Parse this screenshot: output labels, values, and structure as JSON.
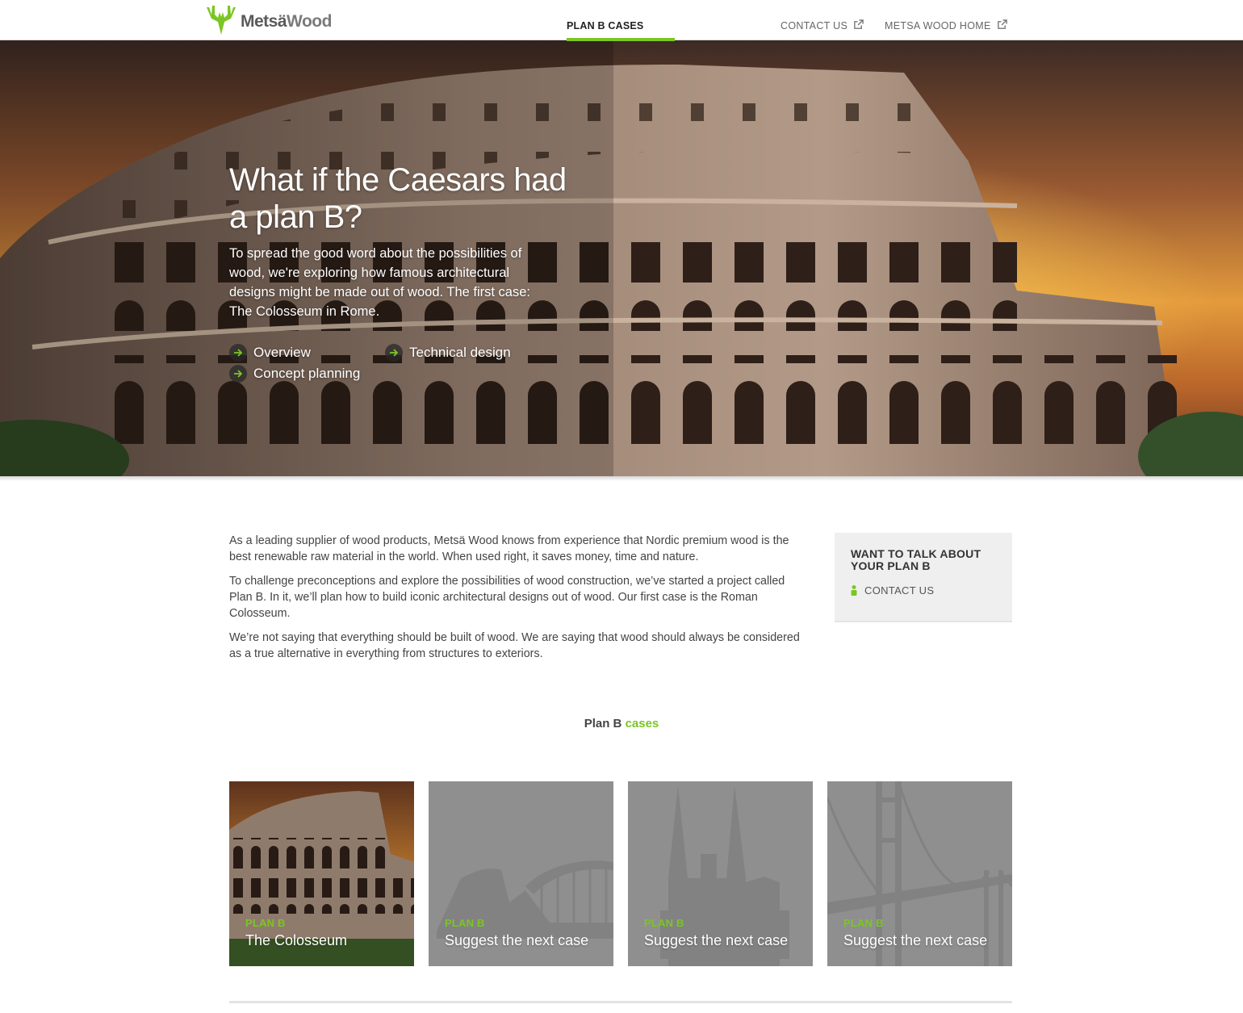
{
  "header": {
    "logo_text_left": "Metsä",
    "logo_text_right": "Wood",
    "nav_active": "PLAN B CASES",
    "nav_contact": "CONTACT US",
    "nav_home": "METSA WOOD HOME",
    "accent_color": "#7bc623"
  },
  "hero": {
    "title": "What if the Caesars had a plan B?",
    "description": "To spread the good word about the possibilities of wood, we're exploring how famous architectural designs might be made out of wood. The first case: The Colosseum in Rome.",
    "links": {
      "overview": "Overview",
      "concept": "Concept planning",
      "technical": "Technical design"
    }
  },
  "intro": {
    "p1": "As a leading supplier of wood products, Metsä Wood knows from experience that Nordic premium wood is the best renewable raw material in the world. When used right, it saves money, time and nature.",
    "p2": "To challenge preconceptions and explore the possibilities of wood construction, we’ve started a project called Plan B. In it, we’ll plan how to build iconic architectural designs out of wood. Our first case is the Roman Colosseum.",
    "p3": "We’re not saying that everything should be built of wood. We are saying that wood should always be considered as a true alternative in everything from structures to exteriors."
  },
  "sidebar": {
    "title": "WANT TO TALK ABOUT YOUR PLAN B",
    "contact": "CONTACT US",
    "contact_icon": "person-icon"
  },
  "cases": {
    "heading_a": "Plan B",
    "heading_b": "cases",
    "items": [
      {
        "tag": "PLAN B",
        "name": "The Colosseum"
      },
      {
        "tag": "PLAN B",
        "name": "Suggest the next case"
      },
      {
        "tag": "PLAN B",
        "name": "Suggest the next case"
      },
      {
        "tag": "PLAN B",
        "name": "Suggest the next case"
      }
    ]
  }
}
